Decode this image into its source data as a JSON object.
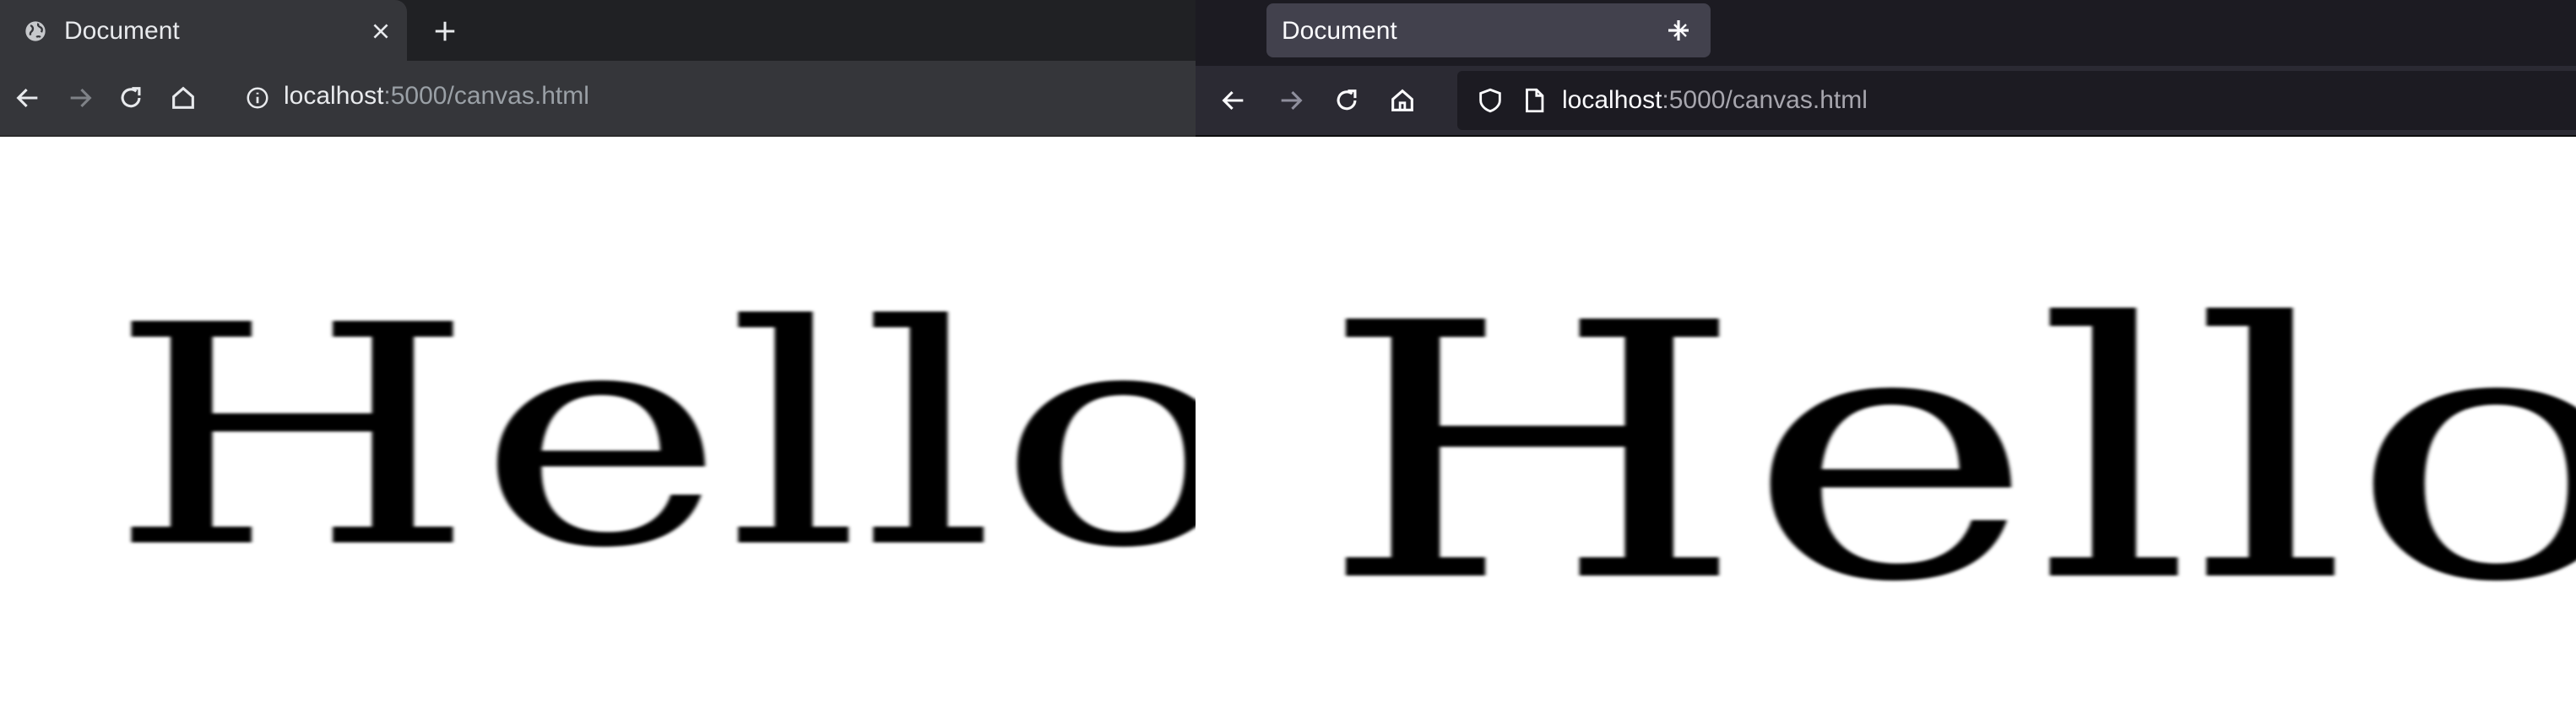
{
  "left_browser": {
    "tab_title": "Document",
    "url_host": "localhost",
    "url_rest": ":5000/canvas.html",
    "canvas_text": "Hello"
  },
  "right_browser": {
    "tab_title": "Document",
    "url_host": "localhost",
    "url_rest": ":5000/canvas.html",
    "canvas_text": "Hello"
  },
  "colors": {
    "chrome_frame": "#202124",
    "chrome_toolbar": "#35363a",
    "firefox_frame": "#1c1b22",
    "firefox_toolbar": "#2b2a33",
    "firefox_active_tab": "#42414d",
    "page_background": "#ffffff",
    "text": "#000000"
  },
  "icons": {
    "left": [
      "globe-icon",
      "close-icon",
      "plus-icon",
      "back-arrow-icon",
      "forward-arrow-icon",
      "reload-icon",
      "home-icon",
      "info-icon"
    ],
    "right": [
      "close-icon",
      "plus-icon",
      "back-arrow-icon",
      "forward-arrow-icon",
      "reload-icon",
      "home-icon",
      "shield-icon",
      "page-icon"
    ]
  }
}
